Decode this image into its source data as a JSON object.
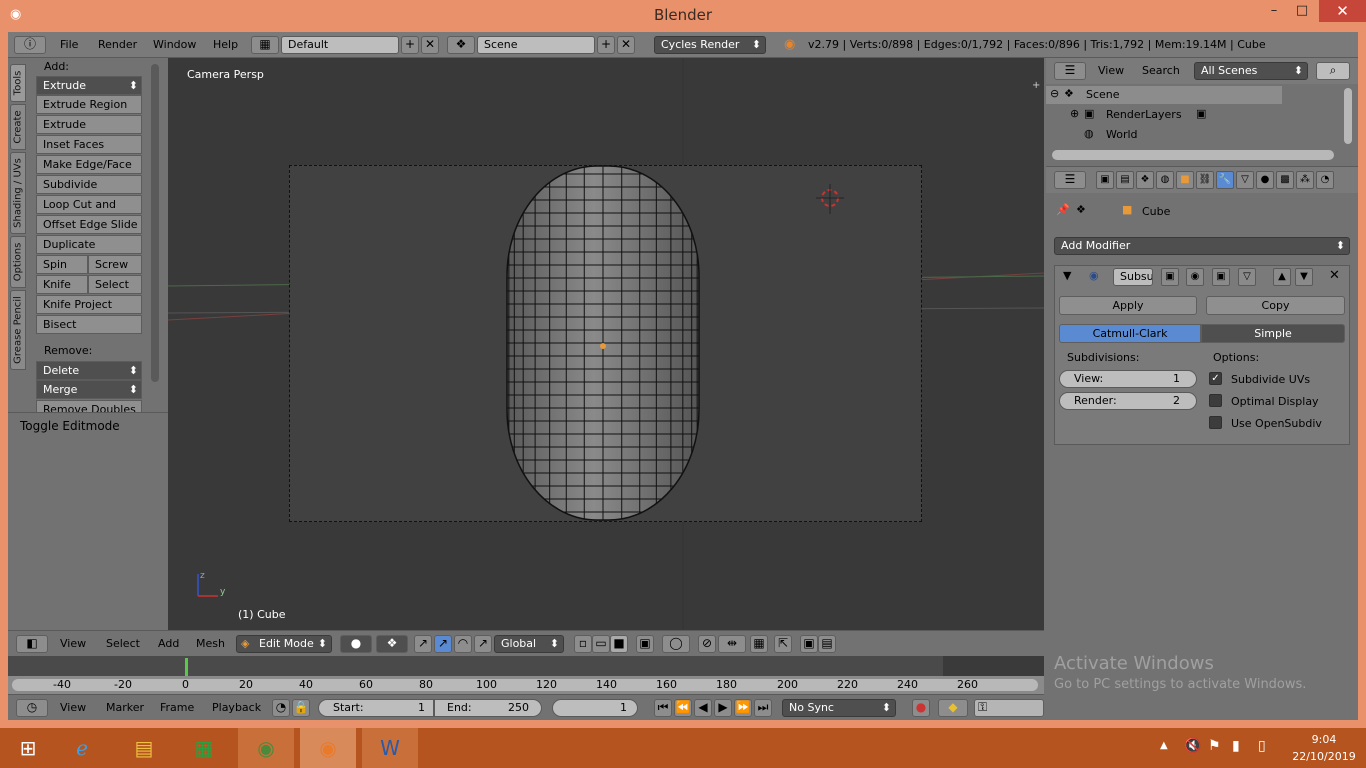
{
  "window": {
    "title": "Blender",
    "min": "–",
    "max": "□",
    "close": "✕"
  },
  "topbar": {
    "menus": [
      "File",
      "Render",
      "Window",
      "Help"
    ],
    "layout": "Default",
    "scene": "Scene",
    "engine": "Cycles Render",
    "stats": "v2.79 | Verts:0/898 | Edges:0/1,792 | Faces:0/896 | Tris:1,792 | Mem:19.14M | Cube"
  },
  "tools": {
    "add_label": "Add:",
    "items": [
      "Extrude",
      "Extrude Region",
      "Extrude Individual",
      "Inset Faces",
      "Make Edge/Face",
      "Subdivide",
      "Loop Cut and Slide",
      "Offset Edge Slide",
      "Duplicate"
    ],
    "spin": "Spin",
    "screw": "Screw",
    "knife": "Knife",
    "select": "Select",
    "knife_project": "Knife Project",
    "bisect": "Bisect",
    "remove_label": "Remove:",
    "delete": "Delete",
    "merge": "Merge",
    "remove_doubles": "Remove Doubles",
    "toggle": "Toggle Editmode",
    "tabs": [
      "Tools",
      "Create",
      "Shading / UVs",
      "Options",
      "Grease Pencil"
    ]
  },
  "viewport": {
    "label": "Camera Persp",
    "object": "(1) Cube"
  },
  "view_header": {
    "menus": [
      "View",
      "Select",
      "Add",
      "Mesh"
    ],
    "mode": "Edit Mode",
    "orientation": "Global"
  },
  "timeline": {
    "ticks": [
      "-40",
      "-20",
      "0",
      "20",
      "40",
      "60",
      "80",
      "100",
      "120",
      "140",
      "160",
      "180",
      "200",
      "220",
      "240",
      "260"
    ],
    "menus": [
      "View",
      "Marker",
      "Frame",
      "Playback"
    ],
    "start_label": "Start:",
    "start": "1",
    "end_label": "End:",
    "end": "250",
    "current": "1",
    "sync": "No Sync"
  },
  "outliner": {
    "menus": [
      "View",
      "Search"
    ],
    "filter": "All Scenes",
    "items": [
      "Scene",
      "RenderLayers",
      "World"
    ]
  },
  "properties": {
    "object": "Cube",
    "add_modifier": "Add Modifier",
    "modifier_name": "Subsu",
    "apply": "Apply",
    "copy": "Copy",
    "catmull": "Catmull-Clark",
    "simple": "Simple",
    "subdivisions": "Subdivisions:",
    "options": "Options:",
    "view_label": "View:",
    "view_val": "1",
    "render_label": "Render:",
    "render_val": "2",
    "opt1": "Subdivide UVs",
    "opt2": "Optimal Display",
    "opt3": "Use OpenSubdiv"
  },
  "watermark": {
    "title": "Activate Windows",
    "sub": "Go to PC settings to activate Windows."
  },
  "clock": {
    "time": "9:04",
    "date": "22/10/2019"
  }
}
